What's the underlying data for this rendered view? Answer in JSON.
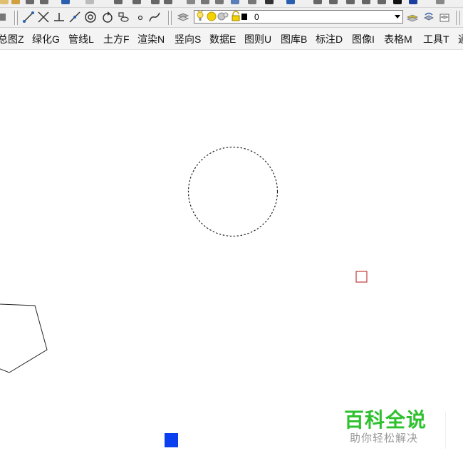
{
  "layer_toolbar": {
    "current_layer": "0"
  },
  "menu": {
    "items": [
      {
        "label": "总图Z"
      },
      {
        "label": "绿化G"
      },
      {
        "label": "管线L"
      },
      {
        "label": "土方F"
      },
      {
        "label": "渲染N"
      },
      {
        "label": "竖向S"
      },
      {
        "label": "数据E"
      },
      {
        "label": "图则U"
      },
      {
        "label": "图库B"
      },
      {
        "label": "标注D"
      },
      {
        "label": "图像I"
      },
      {
        "label": "表格M"
      },
      {
        "label": "工具T"
      },
      {
        "label": "通"
      }
    ]
  },
  "watermark": {
    "title": "百科全说",
    "subtitle": "助你轻松解决"
  },
  "colors": {
    "selection_square": "#c23b3b",
    "blue_square": "#0a3ff0",
    "watermark_green": "#2ec12e"
  },
  "icons": {
    "draw_toolbar": [
      "line-icon",
      "construction-line-icon",
      "perpendicular-icon",
      "polyline-icon",
      "donut-icon",
      "rotate-icon",
      "block-icon",
      "point-icon",
      "spline-icon"
    ],
    "layer_toolbar": [
      "layer-manager-icon",
      "bulb-on-icon",
      "sun-icon",
      "freeze-icon",
      "lock-icon",
      "color-swatch-icon"
    ]
  }
}
